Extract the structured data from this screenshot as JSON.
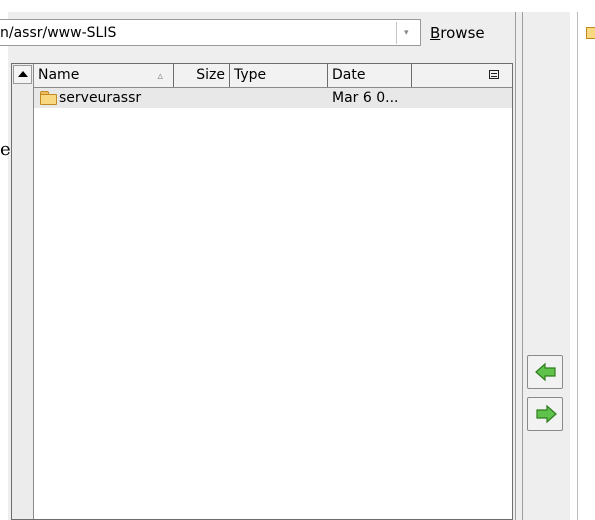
{
  "path_combo": {
    "value": "n/assr/www-SLIS",
    "dropdown_glyph": "▾"
  },
  "browse_button": {
    "mnemonic": "B",
    "rest": "rowse"
  },
  "left_fragment": "e",
  "file_list": {
    "columns": {
      "name": "Name",
      "size": "Size",
      "type": "Type",
      "date": "Date"
    },
    "sort_indicator": "▵",
    "rows": [
      {
        "name": "serveurassr",
        "size": "",
        "type": "",
        "date": "Mar 6 0..."
      }
    ]
  },
  "icons": {
    "scroll_up": "triangle-up",
    "folder": "folder",
    "column_menu": "column-menu",
    "add": "green-arrow-left",
    "remove": "green-arrow-right"
  },
  "colors": {
    "arrow_green": "#5fc24a",
    "arrow_outline": "#2e7d1e",
    "folder_fill": "#f8d880"
  }
}
